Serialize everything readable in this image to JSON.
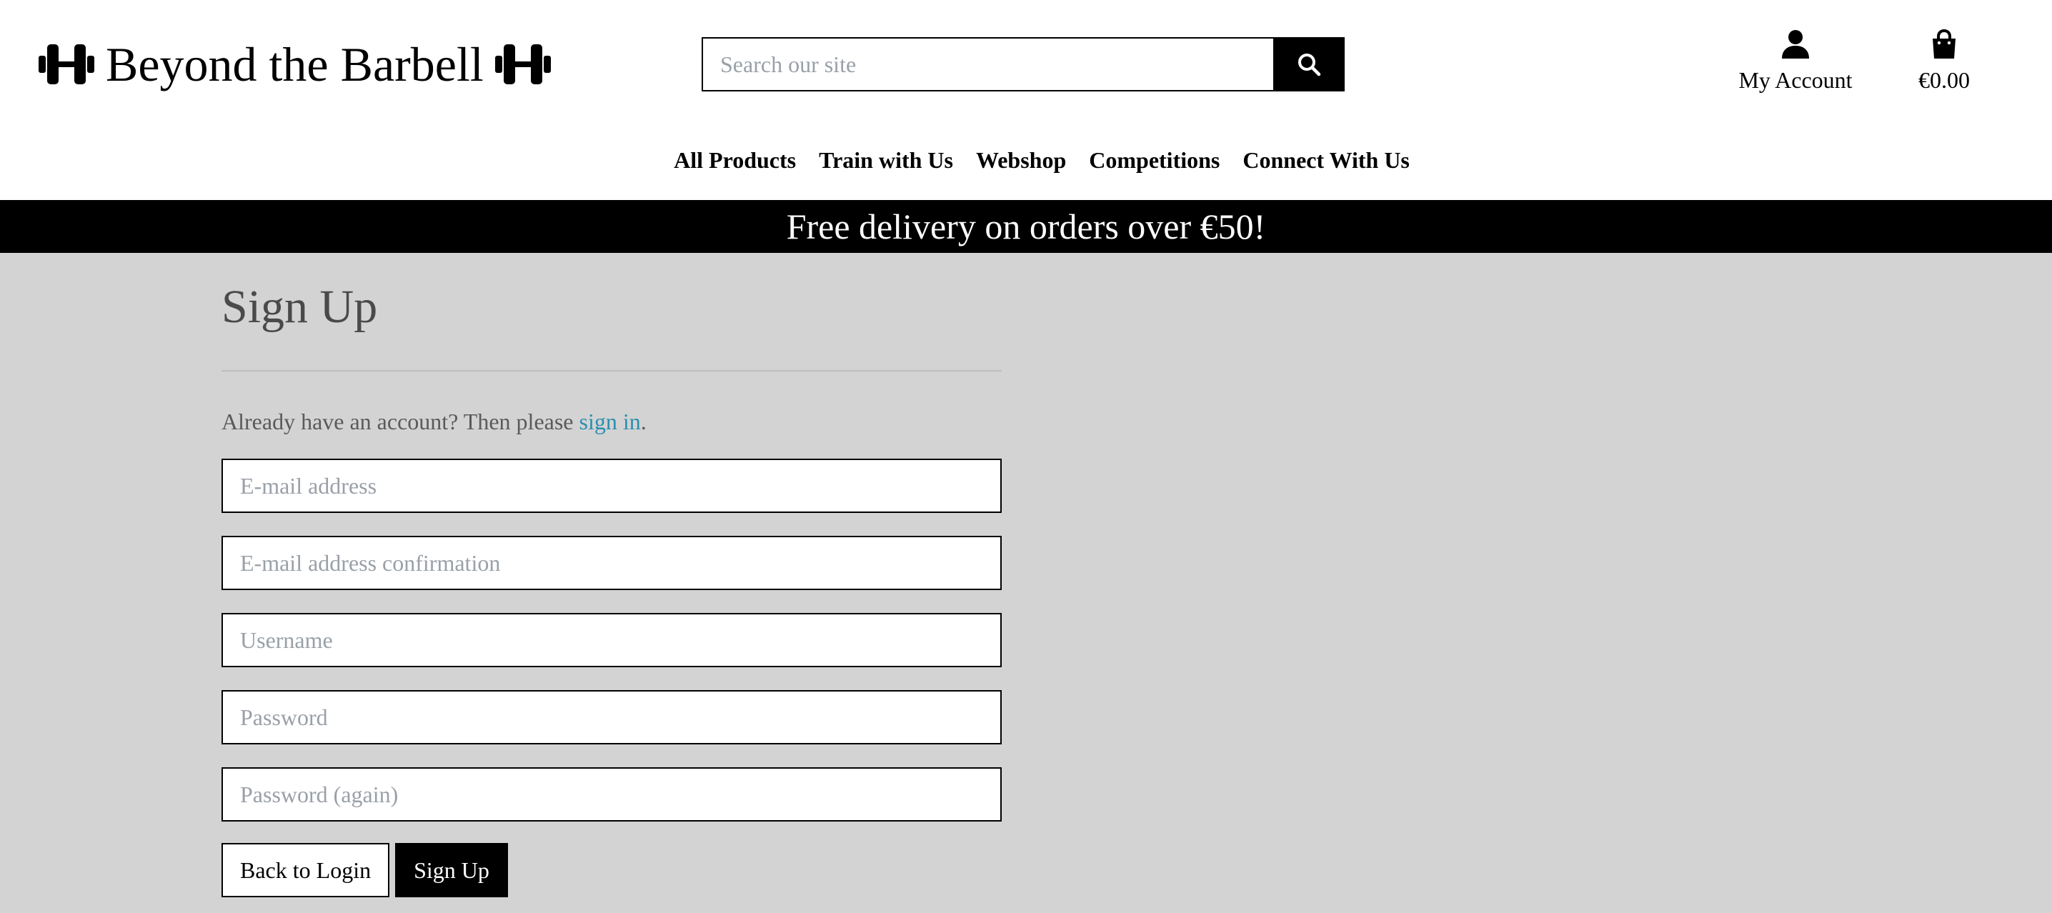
{
  "header": {
    "logo_text": "Beyond the Barbell",
    "logo_icons": [
      "dumbbell-icon",
      "dumbbell-icon"
    ],
    "search": {
      "placeholder": "Search our site",
      "value": "",
      "button_icon": "search-icon"
    },
    "account": {
      "icon": "user-icon",
      "label": "My Account"
    },
    "cart": {
      "icon": "shopping-bag-icon",
      "label": "€0.00"
    }
  },
  "nav": {
    "items": [
      {
        "label": "All Products"
      },
      {
        "label": "Train with Us"
      },
      {
        "label": "Webshop"
      },
      {
        "label": "Competitions"
      },
      {
        "label": "Connect With Us"
      }
    ]
  },
  "banner": {
    "text": "Free delivery on orders over €50!"
  },
  "main": {
    "title": "Sign Up",
    "signin_prompt": "Already have an account? Then please ",
    "signin_link": "sign in",
    "signin_suffix": ".",
    "fields": [
      {
        "placeholder": "E-mail address",
        "value": ""
      },
      {
        "placeholder": "E-mail address confirmation",
        "value": ""
      },
      {
        "placeholder": "Username",
        "value": ""
      },
      {
        "placeholder": "Password",
        "value": ""
      },
      {
        "placeholder": "Password (again)",
        "value": ""
      }
    ],
    "buttons": {
      "back": "Back to Login",
      "submit": "Sign Up"
    }
  },
  "colors": {
    "page_background": "#d3d3d3",
    "header_background": "#ffffff",
    "banner_background": "#000000",
    "link": "#2b8fb0",
    "title_text": "#4a4a4a",
    "primary_button": "#000000"
  }
}
